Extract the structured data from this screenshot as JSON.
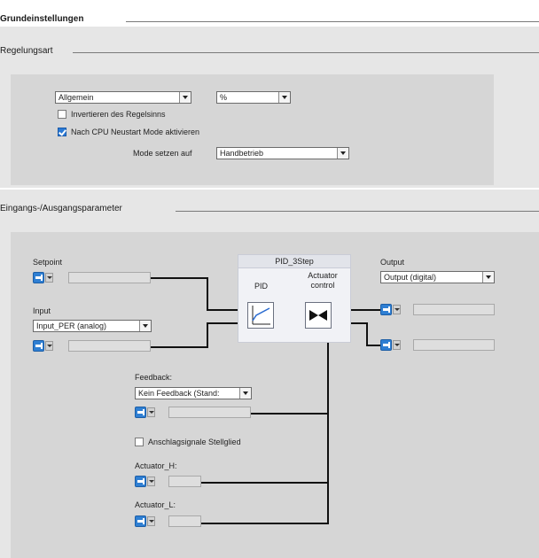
{
  "sections": {
    "basic": "Grundeinstellungen",
    "control_type": "Regelungsart",
    "io_params": "Eingangs-/Ausgangsparameter"
  },
  "control": {
    "type_select": "Allgemein",
    "unit_select": "%",
    "invert_label": "Invertieren des Regelsinns",
    "invert_checked": false,
    "cpu_restart_label": "Nach CPU Neustart Mode aktivieren",
    "cpu_restart_checked": true,
    "mode_label": "Mode setzen auf",
    "mode_select": "Handbetrieb"
  },
  "io": {
    "setpoint_label": "Setpoint",
    "input_label": "Input",
    "input_select": "Input_PER (analog)",
    "output_label": "Output",
    "output_select": "Output (digital)",
    "block_title": "PID_3Step",
    "pid_label": "PID",
    "actuator_label": "Actuator\ncontrol",
    "feedback_label": "Feedback:",
    "feedback_select": "Kein Feedback (Stand:",
    "endstop_label": "Anschlagsignale Stellglied",
    "endstop_checked": false,
    "actuator_h_label": "Actuator_H:",
    "actuator_l_label": "Actuator_L:"
  },
  "colors": {
    "connector_blue": "#2f7fd3",
    "panel_gray": "#d6d6d6",
    "checkbox_blue": "#2a7ad6"
  }
}
